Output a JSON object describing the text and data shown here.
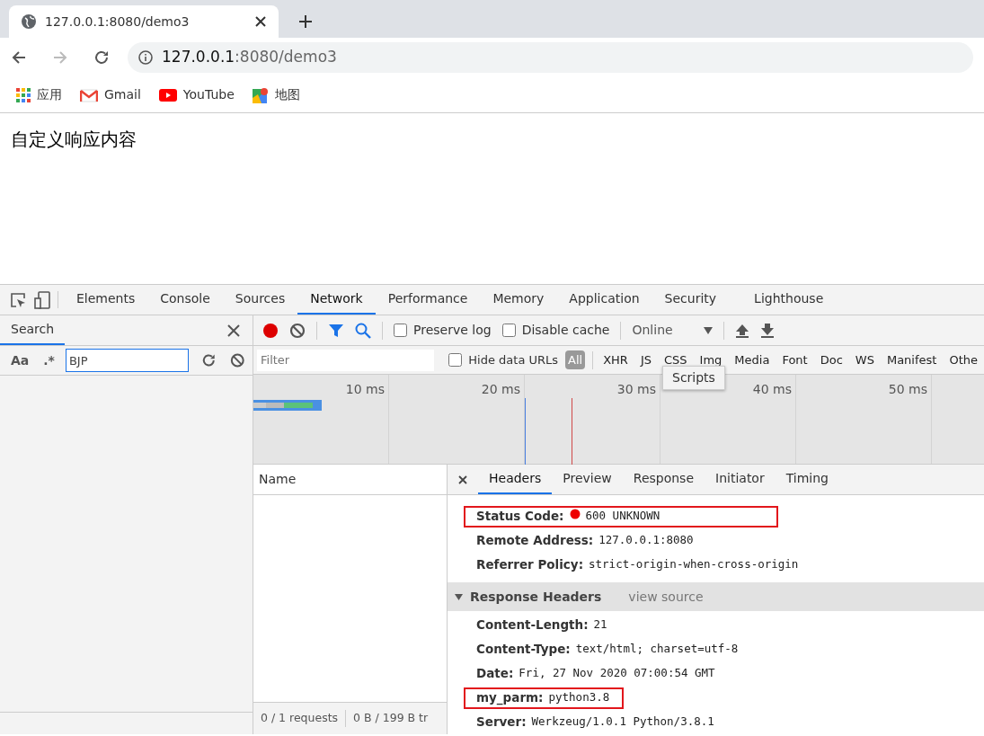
{
  "browser": {
    "tabs": [
      {
        "title": "127.0.0.1:8080/demo3",
        "selected": true
      }
    ],
    "address": {
      "host": "127.0.0.1",
      "rest": ":8080/demo3"
    },
    "bookmarks": [
      {
        "label": "应用",
        "kind": "apps"
      },
      {
        "label": "Gmail",
        "kind": "gmail"
      },
      {
        "label": "YouTube",
        "kind": "youtube"
      },
      {
        "label": "地图",
        "kind": "maps"
      }
    ]
  },
  "page": {
    "text": "自定义响应内容"
  },
  "devtools": {
    "tabs": [
      {
        "label": "Elements",
        "selected": false
      },
      {
        "label": "Console",
        "selected": false
      },
      {
        "label": "Sources",
        "selected": false
      },
      {
        "label": "Network",
        "selected": true
      },
      {
        "label": "Performance",
        "selected": false
      },
      {
        "label": "Memory",
        "selected": false
      },
      {
        "label": "Application",
        "selected": false
      },
      {
        "label": "Security",
        "selected": false
      },
      {
        "label": "Lighthouse",
        "selected": false
      }
    ],
    "search": {
      "title": "Search",
      "case_label": "Aa",
      "regex_label": ".*",
      "value": "BJP"
    },
    "toolbar": {
      "recording": true,
      "preserve_log": {
        "label": "Preserve log",
        "checked": false
      },
      "disable_cache": {
        "label": "Disable cache",
        "checked": false
      },
      "throttle": "Online"
    },
    "filter": {
      "placeholder": "Filter",
      "hide_data_urls": {
        "label": "Hide data URLs",
        "checked": false
      },
      "types": [
        {
          "label": "All",
          "selected": true
        },
        {
          "label": "XHR",
          "selected": false
        },
        {
          "label": "JS",
          "selected": false
        },
        {
          "label": "CSS",
          "selected": false
        },
        {
          "label": "Img",
          "selected": false
        },
        {
          "label": "Media",
          "selected": false
        },
        {
          "label": "Font",
          "selected": false
        },
        {
          "label": "Doc",
          "selected": false
        },
        {
          "label": "WS",
          "selected": false
        },
        {
          "label": "Manifest",
          "selected": false
        },
        {
          "label": "Othe",
          "selected": false
        }
      ]
    },
    "tooltip": "Scripts",
    "overview": {
      "ticks": [
        "10 ms",
        "20 ms",
        "30 ms",
        "40 ms",
        "50 ms"
      ]
    },
    "requests": {
      "column": "Name",
      "summary": [
        "0 / 1 requests",
        "0 B / 199 B tr"
      ]
    },
    "details": {
      "tabs": [
        {
          "label": "Headers",
          "selected": true
        },
        {
          "label": "Preview",
          "selected": false
        },
        {
          "label": "Response",
          "selected": false
        },
        {
          "label": "Initiator",
          "selected": false
        },
        {
          "label": "Timing",
          "selected": false
        }
      ],
      "general": [
        {
          "name": "Status Code:",
          "value": "600 UNKNOWN",
          "kind": "status",
          "highlighted": true
        },
        {
          "name": "Remote Address:",
          "value": "127.0.0.1:8080",
          "kind": "plain",
          "highlighted": false
        },
        {
          "name": "Referrer Policy:",
          "value": "strict-origin-when-cross-origin",
          "kind": "plain",
          "highlighted": false
        }
      ],
      "response_headers": {
        "title": "Response Headers",
        "expanded": true,
        "link": "view source",
        "rows": [
          {
            "name": "Content-Length:",
            "value": "21",
            "highlighted": false
          },
          {
            "name": "Content-Type:",
            "value": "text/html; charset=utf-8",
            "highlighted": false
          },
          {
            "name": "Date:",
            "value": "Fri, 27 Nov 2020 07:00:54 GMT",
            "highlighted": false
          },
          {
            "name": "my_parm:",
            "value": "python3.8",
            "highlighted": true
          },
          {
            "name": "Server:",
            "value": "Werkzeug/1.0.1 Python/3.8.1",
            "highlighted": false
          }
        ]
      }
    }
  }
}
